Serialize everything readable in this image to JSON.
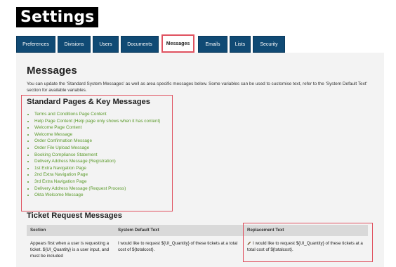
{
  "app": {
    "title": "Settings"
  },
  "tabs": [
    {
      "label": "Preferences"
    },
    {
      "label": "Divisions"
    },
    {
      "label": "Users"
    },
    {
      "label": "Documents"
    },
    {
      "label": "Messages"
    },
    {
      "label": "Emails"
    },
    {
      "label": "Lists"
    },
    {
      "label": "Security"
    }
  ],
  "page": {
    "title": "Messages",
    "intro": "You can update the 'Standard System Messages' as well as area specific messages below. Some variables can be used to customise text, refer to the 'System Default Text' section for available variables."
  },
  "standard": {
    "title": "Standard Pages & Key Messages",
    "links": [
      "Terms and Conditions Page Content",
      "Help Page Content (Help page only shows when it has content)",
      "Welcome Page Content",
      "Welcome Message",
      "Order Confirmation Message",
      "Order File Upload Message",
      "Booking Compliance Statement",
      "Delivery Address Message (Registration)",
      "1st Extra Navigation Page",
      "2nd Extra Navigation Page",
      "3rd Extra Navigation Page",
      "Delivery Address Message (Request Process)",
      "Okta Welcome Message"
    ]
  },
  "ticket": {
    "title": "Ticket Request Messages",
    "columns": [
      "Section",
      "System Default Text",
      "Replacement Text"
    ],
    "row": {
      "section": "Appears first when a user is requesting a ticket. ${UI_Quantity} is a user input, and must be included",
      "default": "I would like to request ${UI_Quantity} of these tickets at a total cost of ${totalcost}.",
      "replacement": "I would like to request ${UI_Quantity} of these tickets at a total cost of ${totalcost}."
    }
  },
  "icons": {
    "edit": "pencil-icon"
  },
  "colors": {
    "tab_bg": "#104a74",
    "link": "#5a9a2a",
    "highlight": "#e05260"
  }
}
